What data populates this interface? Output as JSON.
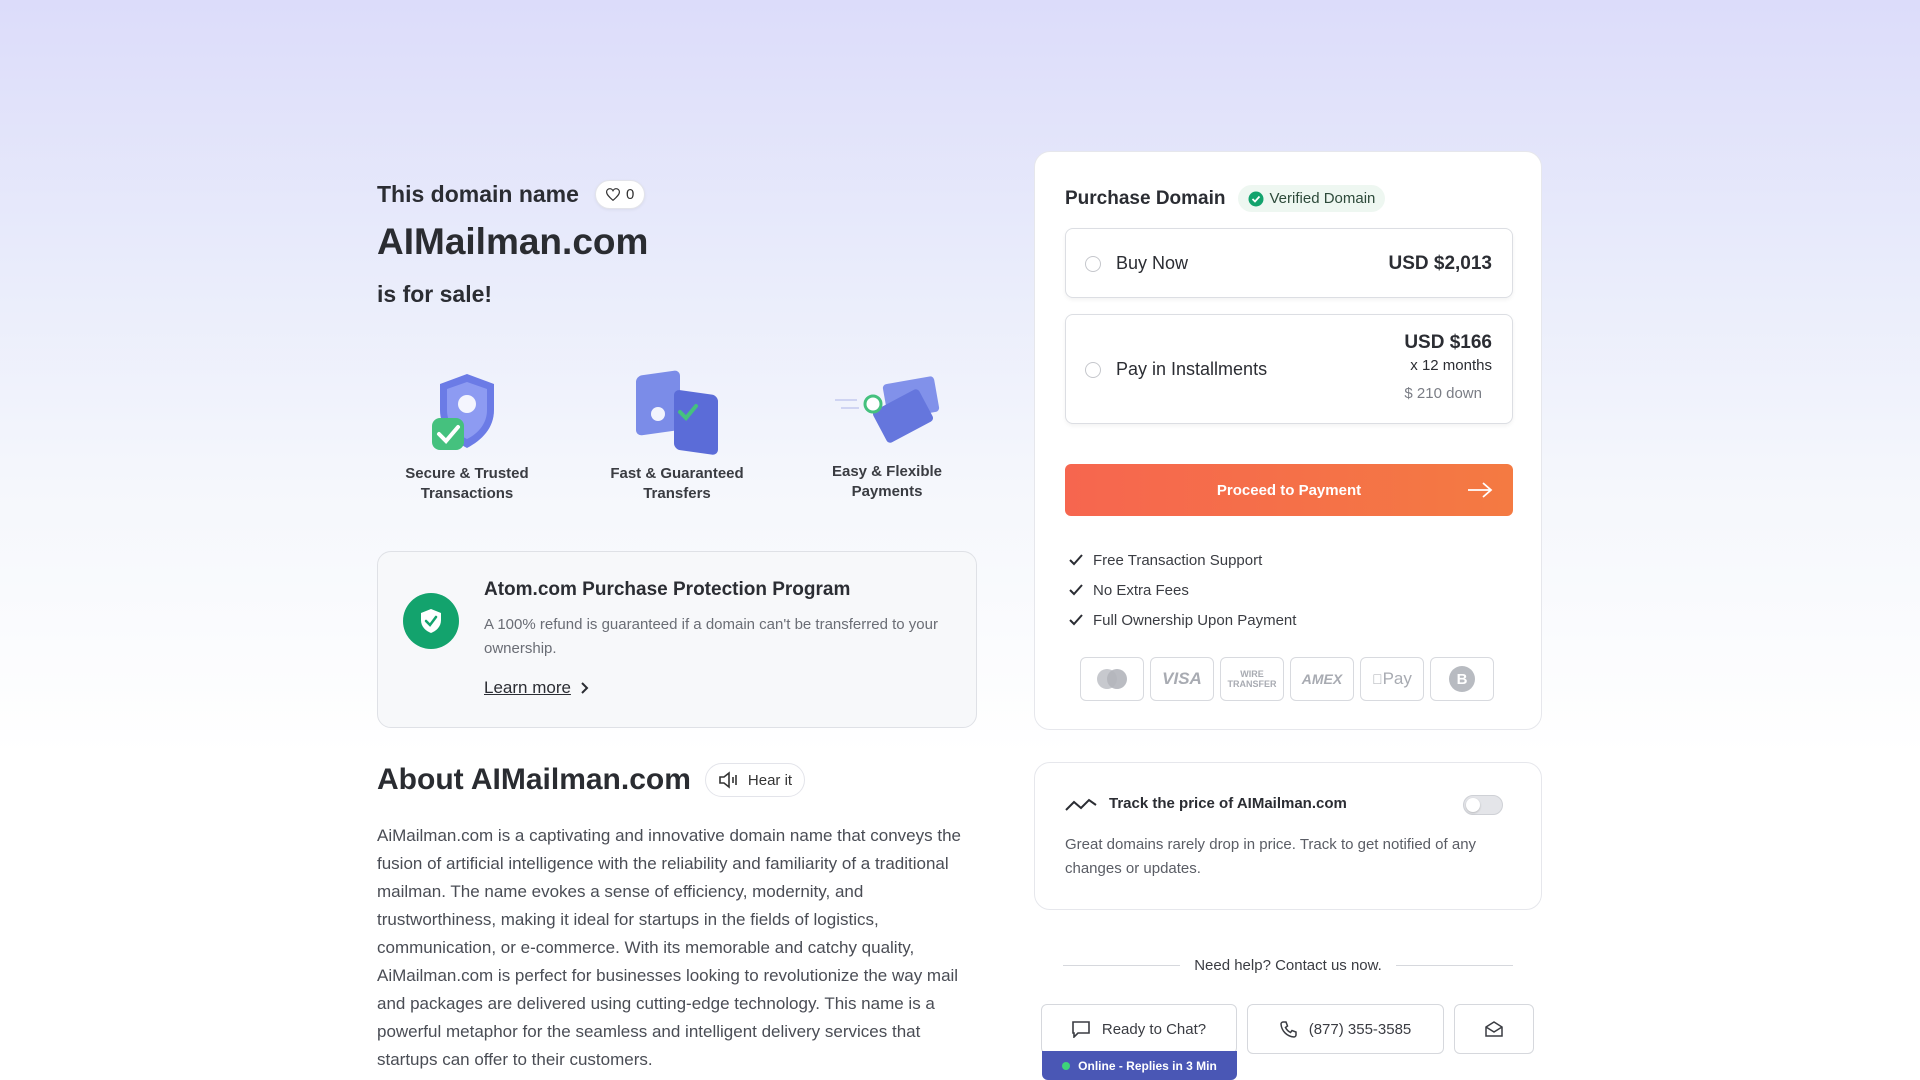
{
  "hero": {
    "title_pre": "This domain name",
    "like_count": "0",
    "domain": "AIMailman.com",
    "for_sale": "is for sale!"
  },
  "features": [
    {
      "label_line1": "Secure & Trusted",
      "label_line2": "Transactions",
      "icon": "shield-check-icon"
    },
    {
      "label_line1": "Fast & Guaranteed",
      "label_line2": "Transfers",
      "icon": "transfer-icon"
    },
    {
      "label_line1": "Easy & Flexible",
      "label_line2": "Payments",
      "icon": "card-payment-icon"
    }
  ],
  "protection": {
    "title": "Atom.com Purchase Protection Program",
    "desc": "A 100% refund is guaranteed if a domain can't be transferred to your ownership.",
    "learn_more": "Learn more"
  },
  "about": {
    "title": "About AIMailman.com",
    "hear_it": "Hear it",
    "text": "AiMailman.com is a captivating and innovative domain name that conveys the fusion of artificial intelligence with the reliability and familiarity of a traditional mailman. The name evokes a sense of efficiency, modernity, and trustworthiness, making it ideal for startups in the fields of logistics, communication, or e-commerce. With its memorable and catchy quality, AiMailman.com is perfect for businesses looking to revolutionize the way mail and packages are delivered using cutting-edge technology. This name is a powerful metaphor for the seamless and intelligent delivery services that startups can offer to their customers."
  },
  "purchase": {
    "title": "Purchase Domain",
    "verified": "Verified Domain",
    "buy_now_label": "Buy Now",
    "buy_now_price": "USD $2,013",
    "installments_label": "Pay in Installments",
    "installments_price": "USD $166",
    "installments_months": "x 12 months",
    "installments_down": "$ 210 down",
    "proceed": "Proceed to Payment",
    "checks": [
      "Free Transaction Support",
      "No Extra Fees",
      "Full Ownership Upon Payment"
    ],
    "payment_methods": [
      "mastercard-icon",
      "VISA",
      "WIRE TRANSFER",
      "AMEX",
      "Pay",
      "bitcoin-icon"
    ]
  },
  "track": {
    "title": "Track the price of AIMailman.com",
    "text": "Great domains rarely drop in price. Track to get notified of any changes or updates.",
    "enabled": false
  },
  "help": {
    "text": "Need help? Contact us now.",
    "chat": "Ready to Chat?",
    "phone": "(877) 355-3585",
    "online": "Online - Replies in 3 Min"
  },
  "colors": {
    "accent_orange": "#f6664f",
    "verified_green": "#13a36d",
    "online_blue": "#4a57b5"
  }
}
